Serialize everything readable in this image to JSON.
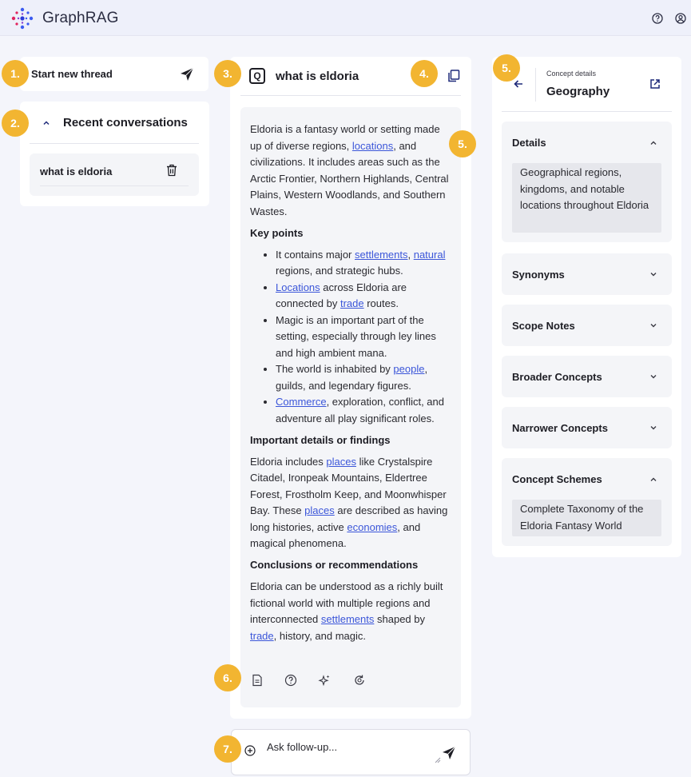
{
  "app": {
    "brand": "GraphRAG"
  },
  "badges": {
    "b1": "1.",
    "b2": "2.",
    "b3": "3.",
    "b4": "4.",
    "b5a": "5.",
    "b5b": "5.",
    "b6": "6.",
    "b7": "7."
  },
  "sidebar": {
    "new_thread_label": "Start new thread",
    "recent_title": "Recent conversations",
    "conversations": [
      {
        "label": "what is eldoria"
      }
    ]
  },
  "thread": {
    "q_icon": "Q",
    "question": "what is eldoria",
    "answer": {
      "intro": {
        "pre": "Eldoria is a fantasy world or setting made up of diverse regions, ",
        "link": "locations",
        "post": ", and civilizations. It includes areas such as the Arctic Frontier, Northern Highlands, Central Plains, Western Woodlands, and Southern Wastes."
      },
      "key_points_heading": "Key points",
      "kp1": {
        "pre": "It contains major ",
        "link1": "settlements",
        "mid": ", ",
        "link2": "natural",
        "post": " regions, and strategic hubs."
      },
      "kp2": {
        "link1": "Locations",
        "mid": " across Eldoria are connected by ",
        "link2": "trade",
        "post": " routes."
      },
      "kp3": "Magic is an important part of the setting, especially through ley lines and high ambient mana.",
      "kp4": {
        "pre": "The world is inhabited by ",
        "link": "people",
        "post": ", guilds, and legendary figures."
      },
      "kp5": {
        "link": "Commerce",
        "post": ", exploration, conflict, and adventure all play significant roles."
      },
      "details_heading": "Important details or findings",
      "details": {
        "pre": "Eldoria includes ",
        "link1": "places",
        "mid1": " like Crystalspire Citadel, Ironpeak Mountains, Eldertree Forest, Frostholm Keep, and Moonwhisper Bay. These ",
        "link2": "places",
        "mid2": " are described as having long histories, active ",
        "link3": "economies",
        "post": ", and magical phenomena."
      },
      "conclusions_heading": "Conclusions or recommendations",
      "conclusions": {
        "pre": "Eldoria can be understood as a richly built fictional world with multiple regions and interconnected ",
        "link1": "settlements",
        "mid": " shaped by ",
        "link2": "trade",
        "post": ", history, and magic."
      }
    },
    "actions": [
      "document-icon",
      "help-circle-icon",
      "sparkles-icon",
      "refresh-icon"
    ]
  },
  "concept": {
    "label": "Concept details",
    "title": "Geography",
    "sections": {
      "details": {
        "title": "Details",
        "expanded": true,
        "body": "Geographical regions, kingdoms, and notable locations throughout Eldoria"
      },
      "synonyms": {
        "title": "Synonyms",
        "expanded": false
      },
      "scope_notes": {
        "title": "Scope Notes",
        "expanded": false
      },
      "broader": {
        "title": "Broader Concepts",
        "expanded": false
      },
      "narrower": {
        "title": "Narrower Concepts",
        "expanded": false
      },
      "schemes": {
        "title": "Concept Schemes",
        "expanded": true,
        "body": "Complete Taxonomy of the Eldoria Fantasy World"
      }
    }
  },
  "composer": {
    "placeholder": "Ask follow-up..."
  },
  "colors": {
    "accent": "#f2b531",
    "link": "#3b56d9",
    "brand_navy": "#1f2a7a",
    "background": "#f4f5fb"
  }
}
